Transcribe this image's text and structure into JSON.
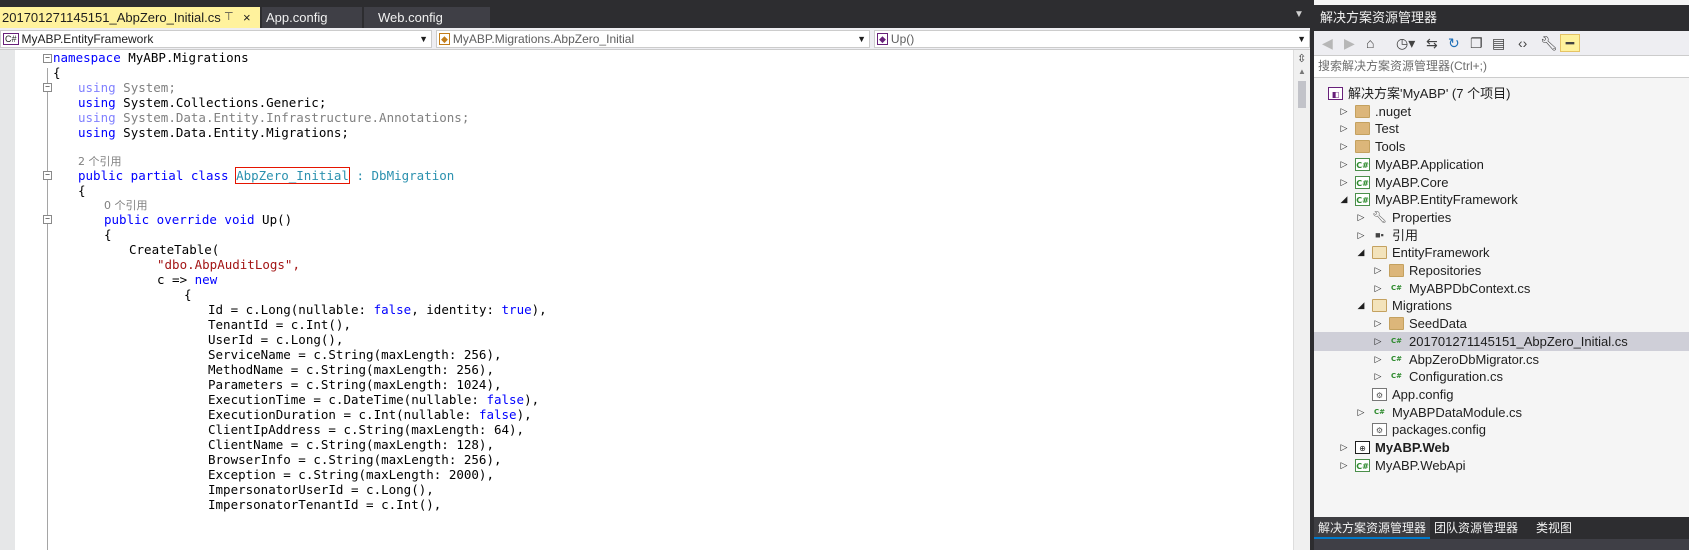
{
  "editor": {
    "tabs": [
      {
        "label": "201701271145151_AbpZero_Initial.cs",
        "active": true
      },
      {
        "label": "App.config",
        "active": false
      },
      {
        "label": "Web.config",
        "active": false
      }
    ],
    "pin_glyph": "⊤",
    "close_glyph": "×",
    "overflow_glyph": "▼",
    "nav": {
      "project": "MyABP.EntityFramework",
      "class": "MyABP.Migrations.AbpZero_Initial",
      "member": "Up()"
    },
    "code": {
      "l1_ns": "namespace",
      "l1_name": " MyABP.Migrations",
      "l2": "{",
      "l3_kw": "using",
      "l3_rest": " System;",
      "l4_kw": "using",
      "l4_rest": " System.Collections.Generic;",
      "l5_kw": "using",
      "l5_rest": " System.Data.Entity.Infrastructure.Annotations;",
      "l6_kw": "using",
      "l6_rest": " System.Data.Entity.Migrations;",
      "ref1": "2 个引用",
      "l8_public": "public",
      "l8_partial": " partial",
      "l8_class": " class",
      "l8_name": "AbpZero_Initial",
      "l8_colon": " : ",
      "l8_base": "DbMigration",
      "l9": "{",
      "ref2": "0 个引用",
      "l11_public": "public",
      "l11_override": " override",
      "l11_void": " void",
      "l11_rest": " Up()",
      "l12": "{",
      "l13": "CreateTable(",
      "l14": "\"dbo.AbpAuditLogs\",",
      "l15_a": "c => ",
      "l15_new": "new",
      "l16": "{",
      "lines": [
        {
          "a": "Id = c.Long(nullable: ",
          "k1": "false",
          "b": ", identity: ",
          "k2": "true",
          "c": "),"
        },
        {
          "a": "TenantId = c.Int(),"
        },
        {
          "a": "UserId = c.Long(),"
        },
        {
          "a": "ServiceName = c.String(maxLength: 256),"
        },
        {
          "a": "MethodName = c.String(maxLength: 256),"
        },
        {
          "a": "Parameters = c.String(maxLength: 1024),"
        },
        {
          "a": "ExecutionTime = c.DateTime(nullable: ",
          "k1": "false",
          "b": "),"
        },
        {
          "a": "ExecutionDuration = c.Int(nullable: ",
          "k1": "false",
          "b": "),"
        },
        {
          "a": "ClientIpAddress = c.String(maxLength: 64),"
        },
        {
          "a": "ClientName = c.String(maxLength: 128),"
        },
        {
          "a": "BrowserInfo = c.String(maxLength: 256),"
        },
        {
          "a": "Exception = c.String(maxLength: 2000),"
        },
        {
          "a": "ImpersonatorUserId = c.Long(),"
        },
        {
          "a": "ImpersonatorTenantId = c.Int(),"
        }
      ]
    }
  },
  "solution_explorer": {
    "title": "解决方案资源管理器",
    "search_placeholder": "搜索解决方案资源管理器(Ctrl+;)",
    "toolbar_icons": [
      "back-icon",
      "forward-icon",
      "home-icon",
      "history-icon",
      "sync-icon",
      "refresh-icon",
      "collapse-all-icon",
      "show-all-files-icon",
      "view-code-icon",
      "properties-icon",
      "preview-icon"
    ],
    "tree": [
      {
        "label": "解决方案'MyABP' (7 个项目)",
        "icon": "solution-icon",
        "kind": "sln",
        "depth": 0,
        "arrow": ""
      },
      {
        "label": ".nuget",
        "icon": "folder-icon",
        "kind": "folder",
        "depth": 1,
        "arrow": "▷"
      },
      {
        "label": "Test",
        "icon": "folder-icon",
        "kind": "folder",
        "depth": 1,
        "arrow": "▷"
      },
      {
        "label": "Tools",
        "icon": "folder-icon",
        "kind": "folder",
        "depth": 1,
        "arrow": "▷"
      },
      {
        "label": "MyABP.Application",
        "icon": "csharp-project-icon",
        "kind": "cs",
        "depth": 1,
        "arrow": "▷"
      },
      {
        "label": "MyABP.Core",
        "icon": "csharp-project-icon",
        "kind": "cs",
        "depth": 1,
        "arrow": "▷"
      },
      {
        "label": "MyABP.EntityFramework",
        "icon": "csharp-project-icon",
        "kind": "cs",
        "depth": 1,
        "arrow": "◢"
      },
      {
        "label": "Properties",
        "icon": "wrench-icon",
        "kind": "wrench",
        "depth": 2,
        "arrow": "▷"
      },
      {
        "label": "引用",
        "icon": "references-icon",
        "kind": "refs",
        "depth": 2,
        "arrow": "▷"
      },
      {
        "label": "EntityFramework",
        "icon": "folder-open-icon",
        "kind": "folder-open",
        "depth": 2,
        "arrow": "◢"
      },
      {
        "label": "Repositories",
        "icon": "folder-icon",
        "kind": "folder",
        "depth": 3,
        "arrow": "▷"
      },
      {
        "label": "MyABPDbContext.cs",
        "icon": "csharp-file-icon",
        "kind": "csfile",
        "depth": 3,
        "arrow": "▷"
      },
      {
        "label": "Migrations",
        "icon": "folder-open-icon",
        "kind": "folder-open",
        "depth": 2,
        "arrow": "◢"
      },
      {
        "label": "SeedData",
        "icon": "folder-icon",
        "kind": "folder",
        "depth": 3,
        "arrow": "▷"
      },
      {
        "label": "201701271145151_AbpZero_Initial.cs",
        "icon": "csharp-file-icon",
        "kind": "csfile",
        "depth": 3,
        "arrow": "▷",
        "selected": true
      },
      {
        "label": "AbpZeroDbMigrator.cs",
        "icon": "csharp-file-icon",
        "kind": "csfile",
        "depth": 3,
        "arrow": "▷"
      },
      {
        "label": "Configuration.cs",
        "icon": "csharp-file-icon",
        "kind": "csfile",
        "depth": 3,
        "arrow": "▷"
      },
      {
        "label": "App.config",
        "icon": "config-file-icon",
        "kind": "config",
        "depth": 2,
        "arrow": ""
      },
      {
        "label": "MyABPDataModule.cs",
        "icon": "csharp-file-icon",
        "kind": "csfile",
        "depth": 2,
        "arrow": "▷"
      },
      {
        "label": "packages.config",
        "icon": "config-file-icon",
        "kind": "config",
        "depth": 2,
        "arrow": ""
      },
      {
        "label": "MyABP.Web",
        "icon": "web-project-icon",
        "kind": "web",
        "depth": 1,
        "arrow": "▷",
        "bold": true
      },
      {
        "label": "MyABP.WebApi",
        "icon": "csharp-project-icon",
        "kind": "cs",
        "depth": 1,
        "arrow": "▷"
      }
    ],
    "bottom_tabs": [
      {
        "label": "解决方案资源管理器",
        "active": true
      },
      {
        "label": "团队资源管理器",
        "active": false
      },
      {
        "label": "类视图",
        "active": false
      }
    ]
  }
}
